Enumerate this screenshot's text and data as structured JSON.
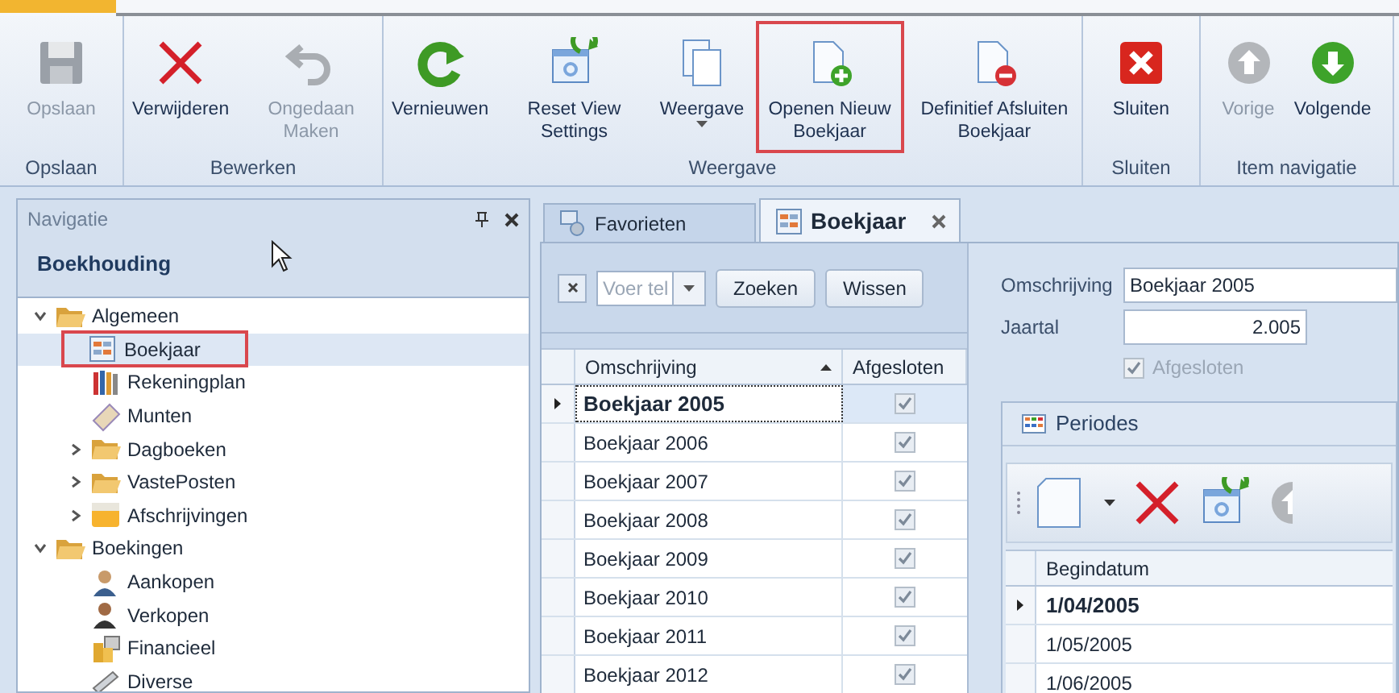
{
  "ribbon": {
    "groups": [
      {
        "label": "Opslaan",
        "buttons": [
          {
            "label": "Opslaan",
            "disabled": true,
            "highlighted": false
          }
        ]
      },
      {
        "label": "Bewerken",
        "buttons": [
          {
            "label": "Verwijderen",
            "disabled": false,
            "highlighted": false
          },
          {
            "label": "Ongedaan Maken",
            "disabled": true,
            "highlighted": false
          }
        ]
      },
      {
        "label": "Weergave",
        "buttons": [
          {
            "label": "Vernieuwen",
            "disabled": false,
            "highlighted": false
          },
          {
            "label": "Reset View Settings",
            "disabled": false,
            "highlighted": false
          },
          {
            "label": "Weergave",
            "disabled": false,
            "highlighted": false,
            "dropdown": true
          },
          {
            "label": "Openen Nieuw Boekjaar",
            "disabled": false,
            "highlighted": true
          },
          {
            "label": "Definitief Afsluiten Boekjaar",
            "disabled": false,
            "highlighted": false
          }
        ]
      },
      {
        "label": "Sluiten",
        "buttons": [
          {
            "label": "Sluiten",
            "disabled": false,
            "highlighted": false
          }
        ]
      },
      {
        "label": "Item navigatie",
        "buttons": [
          {
            "label": "Vorige",
            "disabled": true,
            "highlighted": false
          },
          {
            "label": "Volgende",
            "disabled": false,
            "highlighted": false
          }
        ]
      }
    ]
  },
  "navigation": {
    "title": "Navigatie",
    "section": "Boekhouding",
    "tree": [
      {
        "label": "Algemeen",
        "expanded": true,
        "children": [
          {
            "label": "Boekjaar",
            "selected": true,
            "highlighted": true
          },
          {
            "label": "Rekeningplan",
            "selected": false,
            "highlighted": false
          },
          {
            "label": "Munten",
            "selected": false,
            "highlighted": false
          },
          {
            "label": "Dagboeken",
            "expanded": false,
            "selected": false,
            "highlighted": false
          },
          {
            "label": "VastePosten",
            "expanded": false,
            "selected": false,
            "highlighted": false
          },
          {
            "label": "Afschrijvingen",
            "expanded": false,
            "selected": false,
            "highlighted": false
          }
        ]
      },
      {
        "label": "Boekingen",
        "expanded": true,
        "children": [
          {
            "label": "Aankopen",
            "selected": false,
            "highlighted": false
          },
          {
            "label": "Verkopen",
            "selected": false,
            "highlighted": false
          },
          {
            "label": "Financieel",
            "selected": false,
            "highlighted": false
          },
          {
            "label": "Diverse",
            "selected": false,
            "highlighted": false
          }
        ]
      }
    ]
  },
  "tabs": [
    {
      "label": "Favorieten",
      "selected": false,
      "closable": false
    },
    {
      "label": "Boekjaar",
      "selected": true,
      "closable": true
    }
  ],
  "search": {
    "placeholder": "Voer tel",
    "buttons": [
      "Zoeken",
      "Wissen"
    ]
  },
  "grid": {
    "columns": [
      "Omschrijving",
      "Afgesloten"
    ],
    "rows": [
      {
        "omschrijving": "Boekjaar 2005",
        "afgesloten": true,
        "selected": true
      },
      {
        "omschrijving": "Boekjaar 2006",
        "afgesloten": true,
        "selected": false
      },
      {
        "omschrijving": "Boekjaar 2007",
        "afgesloten": true,
        "selected": false
      },
      {
        "omschrijving": "Boekjaar 2008",
        "afgesloten": true,
        "selected": false
      },
      {
        "omschrijving": "Boekjaar 2009",
        "afgesloten": true,
        "selected": false
      },
      {
        "omschrijving": "Boekjaar 2010",
        "afgesloten": true,
        "selected": false
      },
      {
        "omschrijving": "Boekjaar 2011",
        "afgesloten": true,
        "selected": false
      },
      {
        "omschrijving": "Boekjaar 2012",
        "afgesloten": true,
        "selected": false
      }
    ]
  },
  "detail": {
    "omschrijving_label": "Omschrijving",
    "omschrijving": "Boekjaar 2005",
    "jaartal_label": "Jaartal",
    "jaartal": "2.005",
    "afgesloten_label": "Afgesloten",
    "afgesloten": true
  },
  "periodes": {
    "title": "Periodes",
    "columns": [
      "Begindatum"
    ],
    "rows": [
      {
        "begindatum": "1/04/2005",
        "selected": true
      },
      {
        "begindatum": "1/05/2005",
        "selected": false
      },
      {
        "begindatum": "1/06/2005",
        "selected": false
      }
    ]
  }
}
